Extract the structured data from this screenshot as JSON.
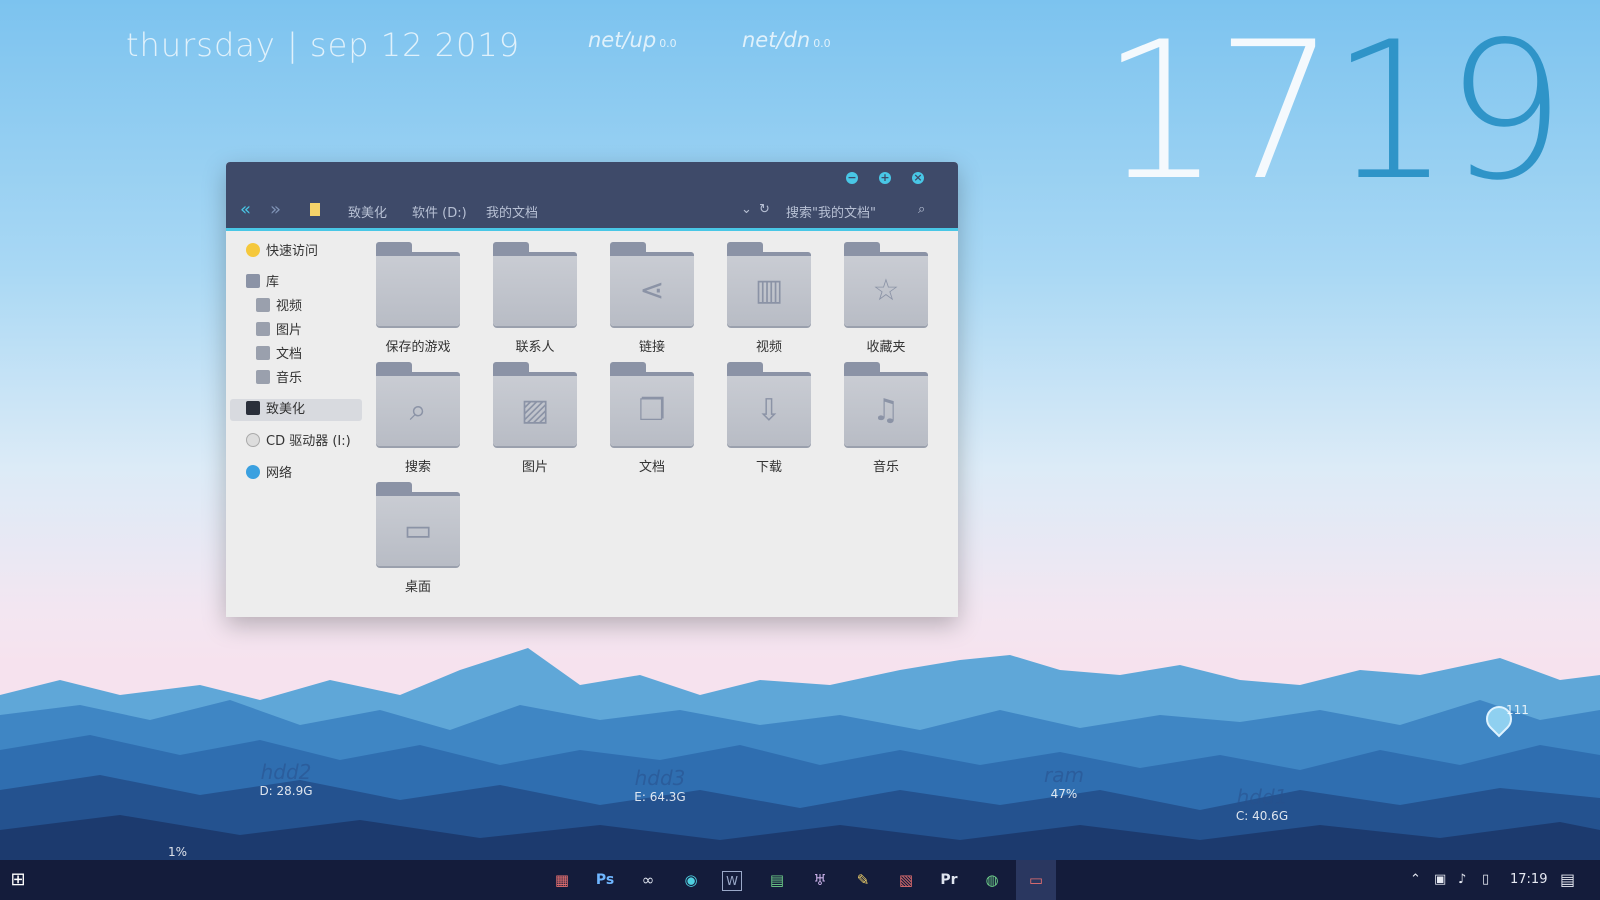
{
  "desktop": {
    "date_text": "thursday | sep 12 2019",
    "net_up_label": "net/up",
    "net_up_value": "0.0",
    "net_dn_label": "net/dn",
    "net_dn_value": "0.0",
    "clock_hours": "17",
    "clock_minutes": "19",
    "weather_value": "111",
    "stats": [
      {
        "label": "hdd2",
        "value": "D: 28.9G"
      },
      {
        "label": "hdd3",
        "value": "E: 64.3G"
      },
      {
        "label": "ram",
        "value": "47%"
      },
      {
        "label": "hdd1",
        "value": "C: 40.6G"
      }
    ],
    "cpu_value": "1%",
    "colors": {
      "clock_hours": "#f4f9fd",
      "clock_minutes": "#2f94c8",
      "accent": "#49c7e6"
    }
  },
  "explorer": {
    "window_controls": [
      "minimize-icon",
      "maximize-icon",
      "close-icon"
    ],
    "breadcrumb": [
      "致美化",
      "软件 (D:)",
      "我的文档"
    ],
    "search_placeholder": "搜索\"我的文档\"",
    "sidebar": {
      "quick_access": "快速访问",
      "library": "库",
      "library_items": [
        "视频",
        "图片",
        "文档",
        "音乐"
      ],
      "this_pc": "致美化",
      "cd_drive": "CD 驱动器 (I:)",
      "network": "网络"
    },
    "folders": [
      {
        "name": "保存的游戏",
        "icon": "folder-icon"
      },
      {
        "name": "联系人",
        "icon": "folder-icon"
      },
      {
        "name": "链接",
        "icon": "share-icon"
      },
      {
        "name": "视频",
        "icon": "film-icon"
      },
      {
        "name": "收藏夹",
        "icon": "star-icon"
      },
      {
        "name": "搜索",
        "icon": "search-icon"
      },
      {
        "name": "图片",
        "icon": "picture-icon"
      },
      {
        "name": "文档",
        "icon": "document-icon"
      },
      {
        "name": "下载",
        "icon": "download-icon"
      },
      {
        "name": "音乐",
        "icon": "music-icon"
      },
      {
        "name": "桌面",
        "icon": "desktop-icon"
      }
    ]
  },
  "taskbar": {
    "apps": [
      "apps-icon",
      "photoshop-icon",
      "link-icon",
      "camera-icon",
      "word-icon",
      "sheet-icon",
      "browser-icon",
      "pen-icon",
      "image-icon",
      "premiere-icon",
      "globe-icon",
      "display-icon"
    ],
    "photoshop_label": "Ps",
    "premiere_label": "Pr",
    "word_label": "W",
    "time": "17:19"
  }
}
